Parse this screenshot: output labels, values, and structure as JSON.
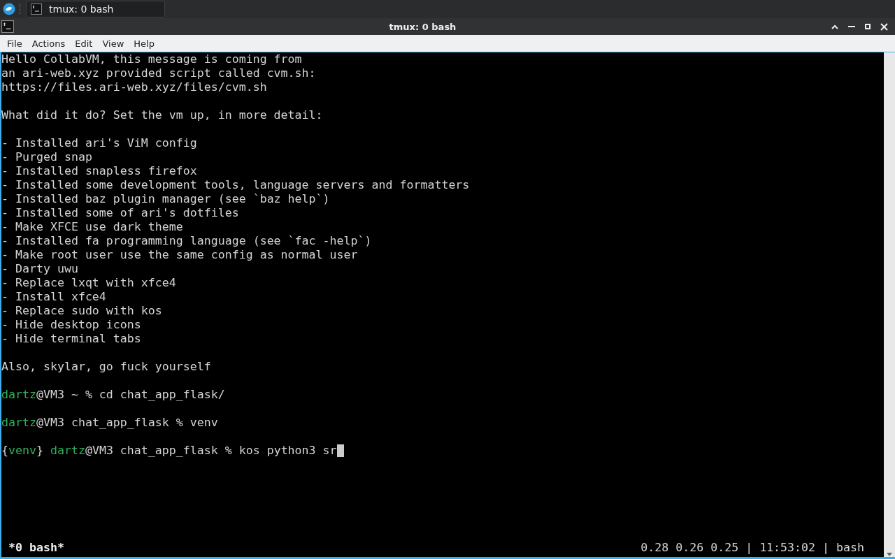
{
  "taskbar": {
    "task": {
      "title": "tmux: 0 bash",
      "selected": true
    }
  },
  "window": {
    "title": "tmux: 0 bash"
  },
  "menu": [
    "File",
    "Actions",
    "Edit",
    "View",
    "Help"
  ],
  "terminal": {
    "lines": [
      {
        "kind": "text",
        "segments": [
          {
            "kind": "plain",
            "text": "Hello CollabVM, this message is coming from"
          }
        ]
      },
      {
        "kind": "text",
        "segments": [
          {
            "kind": "plain",
            "text": "an ari-web.xyz provided script called cvm.sh:"
          }
        ]
      },
      {
        "kind": "text",
        "segments": [
          {
            "kind": "plain",
            "text": "https://files.ari-web.xyz/files/cvm.sh"
          }
        ]
      },
      {
        "kind": "blank"
      },
      {
        "kind": "text",
        "segments": [
          {
            "kind": "plain",
            "text": "What did it do? Set the vm up, in more detail:"
          }
        ]
      },
      {
        "kind": "blank"
      },
      {
        "kind": "text",
        "segments": [
          {
            "kind": "plain",
            "text": "- Installed ari's ViM config"
          }
        ]
      },
      {
        "kind": "text",
        "segments": [
          {
            "kind": "plain",
            "text": "- Purged snap"
          }
        ]
      },
      {
        "kind": "text",
        "segments": [
          {
            "kind": "plain",
            "text": "- Installed snapless firefox"
          }
        ]
      },
      {
        "kind": "text",
        "segments": [
          {
            "kind": "plain",
            "text": "- Installed some development tools, language servers and formatters"
          }
        ]
      },
      {
        "kind": "text",
        "segments": [
          {
            "kind": "plain",
            "text": "- Installed baz plugin manager (see `baz help`)"
          }
        ]
      },
      {
        "kind": "text",
        "segments": [
          {
            "kind": "plain",
            "text": "- Installed some of ari's dotfiles"
          }
        ]
      },
      {
        "kind": "text",
        "segments": [
          {
            "kind": "plain",
            "text": "- Make XFCE use dark theme"
          }
        ]
      },
      {
        "kind": "text",
        "segments": [
          {
            "kind": "plain",
            "text": "- Installed fa programming language (see `fac -help`)"
          }
        ]
      },
      {
        "kind": "text",
        "segments": [
          {
            "kind": "plain",
            "text": "- Make root user use the same config as normal user"
          }
        ]
      },
      {
        "kind": "text",
        "segments": [
          {
            "kind": "plain",
            "text": "- Darty uwu"
          }
        ]
      },
      {
        "kind": "text",
        "segments": [
          {
            "kind": "plain",
            "text": "- Replace lxqt with xfce4"
          }
        ]
      },
      {
        "kind": "text",
        "segments": [
          {
            "kind": "plain",
            "text": "- Install xfce4"
          }
        ]
      },
      {
        "kind": "text",
        "segments": [
          {
            "kind": "plain",
            "text": "- Replace sudo with kos"
          }
        ]
      },
      {
        "kind": "text",
        "segments": [
          {
            "kind": "plain",
            "text": "- Hide desktop icons"
          }
        ]
      },
      {
        "kind": "text",
        "segments": [
          {
            "kind": "plain",
            "text": "- Hide terminal tabs"
          }
        ]
      },
      {
        "kind": "blank"
      },
      {
        "kind": "text",
        "segments": [
          {
            "kind": "plain",
            "text": "Also, skylar, go fuck yourself"
          }
        ]
      },
      {
        "kind": "blank"
      },
      {
        "kind": "text",
        "segments": [
          {
            "kind": "green",
            "text": "dartz"
          },
          {
            "kind": "plain",
            "text": "@VM3 ~ % cd chat_app_flask/"
          }
        ]
      },
      {
        "kind": "blank"
      },
      {
        "kind": "text",
        "segments": [
          {
            "kind": "green",
            "text": "dartz"
          },
          {
            "kind": "plain",
            "text": "@VM3 chat_app_flask % venv"
          }
        ]
      },
      {
        "kind": "blank"
      },
      {
        "kind": "text",
        "cursor": true,
        "segments": [
          {
            "kind": "plain",
            "text": "{"
          },
          {
            "kind": "green",
            "text": "venv"
          },
          {
            "kind": "plain",
            "text": "} "
          },
          {
            "kind": "green",
            "text": "dartz"
          },
          {
            "kind": "plain",
            "text": "@VM3 chat_app_flask % kos python3 sr"
          }
        ]
      }
    ],
    "status_left": "*0 bash*",
    "status_right": "0.28 0.26 0.25 | 11:53:02 | bash"
  }
}
